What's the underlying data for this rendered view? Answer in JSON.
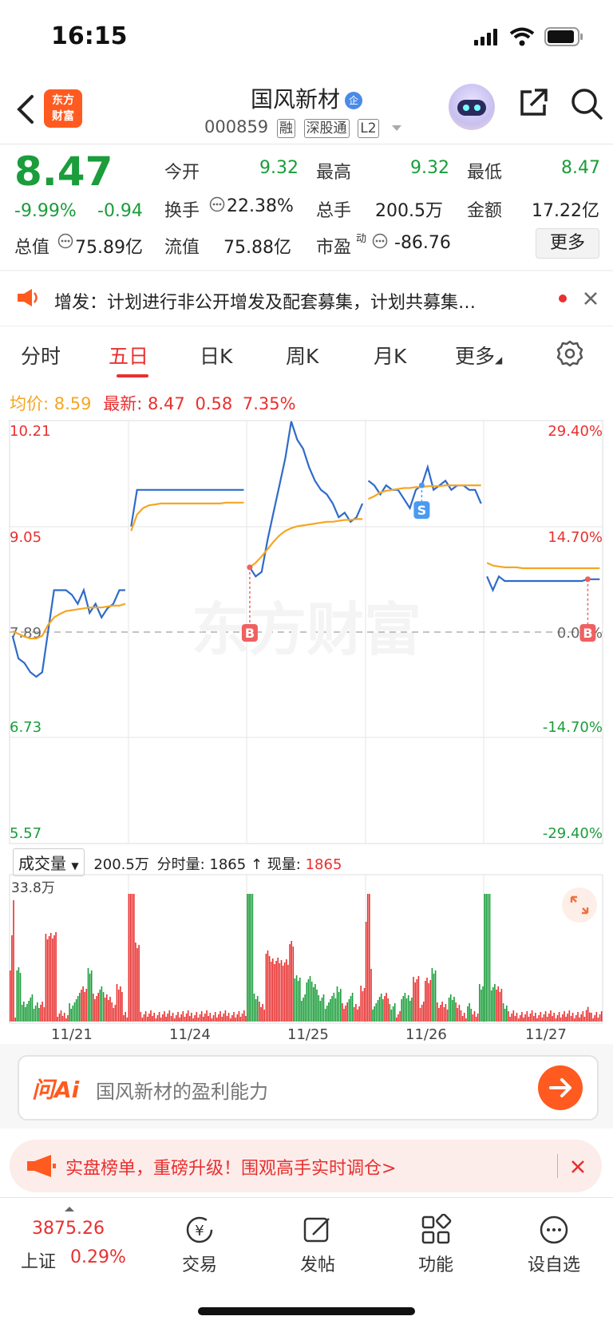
{
  "status_bar": {
    "time": "16:15"
  },
  "header": {
    "logo_text_line1": "东方",
    "logo_text_line2": "财富",
    "stock_name": "国风新材",
    "name_badge": "企",
    "stock_code": "000859",
    "tags": [
      "融",
      "深股通",
      "L2"
    ]
  },
  "quote": {
    "price": "8.47",
    "change_pct": "-9.99%",
    "change_amt": "-0.94",
    "fields": {
      "open_label": "今开",
      "open": "9.32",
      "high_label": "最高",
      "high": "9.32",
      "low_label": "最低",
      "low": "8.47",
      "turnover_label": "换手",
      "turnover": "22.38%",
      "volume_label": "总手",
      "volume": "200.5万",
      "amount_label": "金额",
      "amount": "17.22亿",
      "mktcap_label": "总值",
      "mktcap": "75.89亿",
      "float_label": "流值",
      "float": "75.88亿",
      "pe_label": "市盈",
      "pe_sup": "动",
      "pe": "-86.76"
    },
    "more_label": "更多"
  },
  "notice": {
    "text": "增发：计划进行非公开增发及配套募集，计划共募集…"
  },
  "tabs": [
    "分时",
    "五日",
    "日K",
    "周K",
    "月K",
    "更多"
  ],
  "active_tab": "五日",
  "summary": {
    "avg_label": "均价:",
    "avg": "8.59",
    "latest_label": "最新:",
    "latest": "8.47",
    "change": "0.58",
    "change_pct": "7.35%"
  },
  "chart_data": {
    "type": "line",
    "title": "",
    "watermark": "东方财富",
    "x_labels": [
      "11/21",
      "11/24",
      "11/25",
      "11/26",
      "11/27"
    ],
    "y_left_labels": [
      "10.21",
      "9.05",
      "7.89",
      "6.73",
      "5.57"
    ],
    "y_right_labels": [
      "29.40%",
      "14.70%",
      "0.00%",
      "-14.70%",
      "-29.40%"
    ],
    "ylim": [
      5.57,
      10.21
    ],
    "prev_close": 7.89,
    "series": [
      {
        "name": "最新",
        "color": "#2f6bc9",
        "values": [
          7.85,
          7.6,
          7.55,
          7.45,
          7.4,
          7.45,
          7.9,
          8.35,
          8.35,
          8.35,
          8.3,
          8.2,
          8.35,
          8.1,
          8.2,
          8.05,
          8.15,
          8.2,
          8.35,
          8.35,
          9.05,
          9.45,
          9.45,
          9.45,
          9.45,
          9.45,
          9.45,
          9.45,
          9.45,
          9.45,
          9.45,
          9.45,
          9.45,
          9.45,
          9.45,
          9.45,
          9.45,
          9.45,
          9.45,
          9.45,
          8.6,
          8.5,
          8.55,
          8.9,
          9.2,
          9.5,
          9.8,
          10.2,
          10.0,
          9.9,
          9.7,
          9.55,
          9.45,
          9.4,
          9.3,
          9.15,
          9.2,
          9.1,
          9.15,
          9.3,
          9.55,
          9.5,
          9.4,
          9.5,
          9.45,
          9.45,
          9.35,
          9.25,
          9.45,
          9.5,
          9.7,
          9.45,
          9.5,
          9.55,
          9.45,
          9.5,
          9.5,
          9.45,
          9.45,
          9.3,
          8.5,
          8.35,
          8.5,
          8.45,
          8.45,
          8.45,
          8.45,
          8.45,
          8.45,
          8.45,
          8.45,
          8.45,
          8.45,
          8.45,
          8.45,
          8.45,
          8.45,
          8.47,
          8.47,
          8.47
        ]
      },
      {
        "name": "均价",
        "color": "#f5a623",
        "values": [
          7.9,
          7.87,
          7.84,
          7.82,
          7.82,
          7.85,
          7.97,
          8.05,
          8.09,
          8.12,
          8.13,
          8.14,
          8.15,
          8.16,
          8.16,
          8.16,
          8.17,
          8.18,
          8.18,
          8.2,
          9.0,
          9.18,
          9.25,
          9.28,
          9.29,
          9.3,
          9.3,
          9.3,
          9.3,
          9.3,
          9.3,
          9.3,
          9.3,
          9.3,
          9.3,
          9.3,
          9.31,
          9.31,
          9.31,
          9.31,
          8.6,
          8.65,
          8.72,
          8.8,
          8.88,
          8.95,
          9.0,
          9.03,
          9.05,
          9.06,
          9.07,
          9.08,
          9.09,
          9.1,
          9.1,
          9.11,
          9.12,
          9.12,
          9.13,
          9.13,
          9.35,
          9.38,
          9.42,
          9.44,
          9.45,
          9.46,
          9.47,
          9.47,
          9.48,
          9.48,
          9.49,
          9.49,
          9.49,
          9.5,
          9.5,
          9.5,
          9.5,
          9.5,
          9.5,
          9.5,
          8.65,
          8.62,
          8.61,
          8.6,
          8.6,
          8.6,
          8.59,
          8.59,
          8.59,
          8.59,
          8.59,
          8.59,
          8.59,
          8.59,
          8.59,
          8.59,
          8.59,
          8.59,
          8.59,
          8.59
        ]
      }
    ],
    "markers": [
      {
        "label": "B",
        "type": "buy",
        "index": 40
      },
      {
        "label": "S",
        "type": "sell",
        "index": 69
      },
      {
        "label": "B",
        "type": "buy",
        "index": 97
      }
    ]
  },
  "volume": {
    "selector_label": "成交量",
    "total": "200.5万",
    "period_label": "分时量:",
    "period_value": "1865",
    "now_label": "现量:",
    "now_value": "1865",
    "max_label": "33.8万",
    "up_color": "#e8302f",
    "down_color": "#1a9d3a"
  },
  "ask": {
    "brand": "问Ai",
    "placeholder": "国风新材的盈利能力"
  },
  "banner": {
    "text": "实盘榜单，重磅升级！围观高手实时调仓>"
  },
  "bottom_nav": {
    "index_value": "3875.26",
    "index_name": "上证",
    "index_change": "0.29%",
    "items": [
      "交易",
      "发帖",
      "功能",
      "设自选"
    ]
  }
}
